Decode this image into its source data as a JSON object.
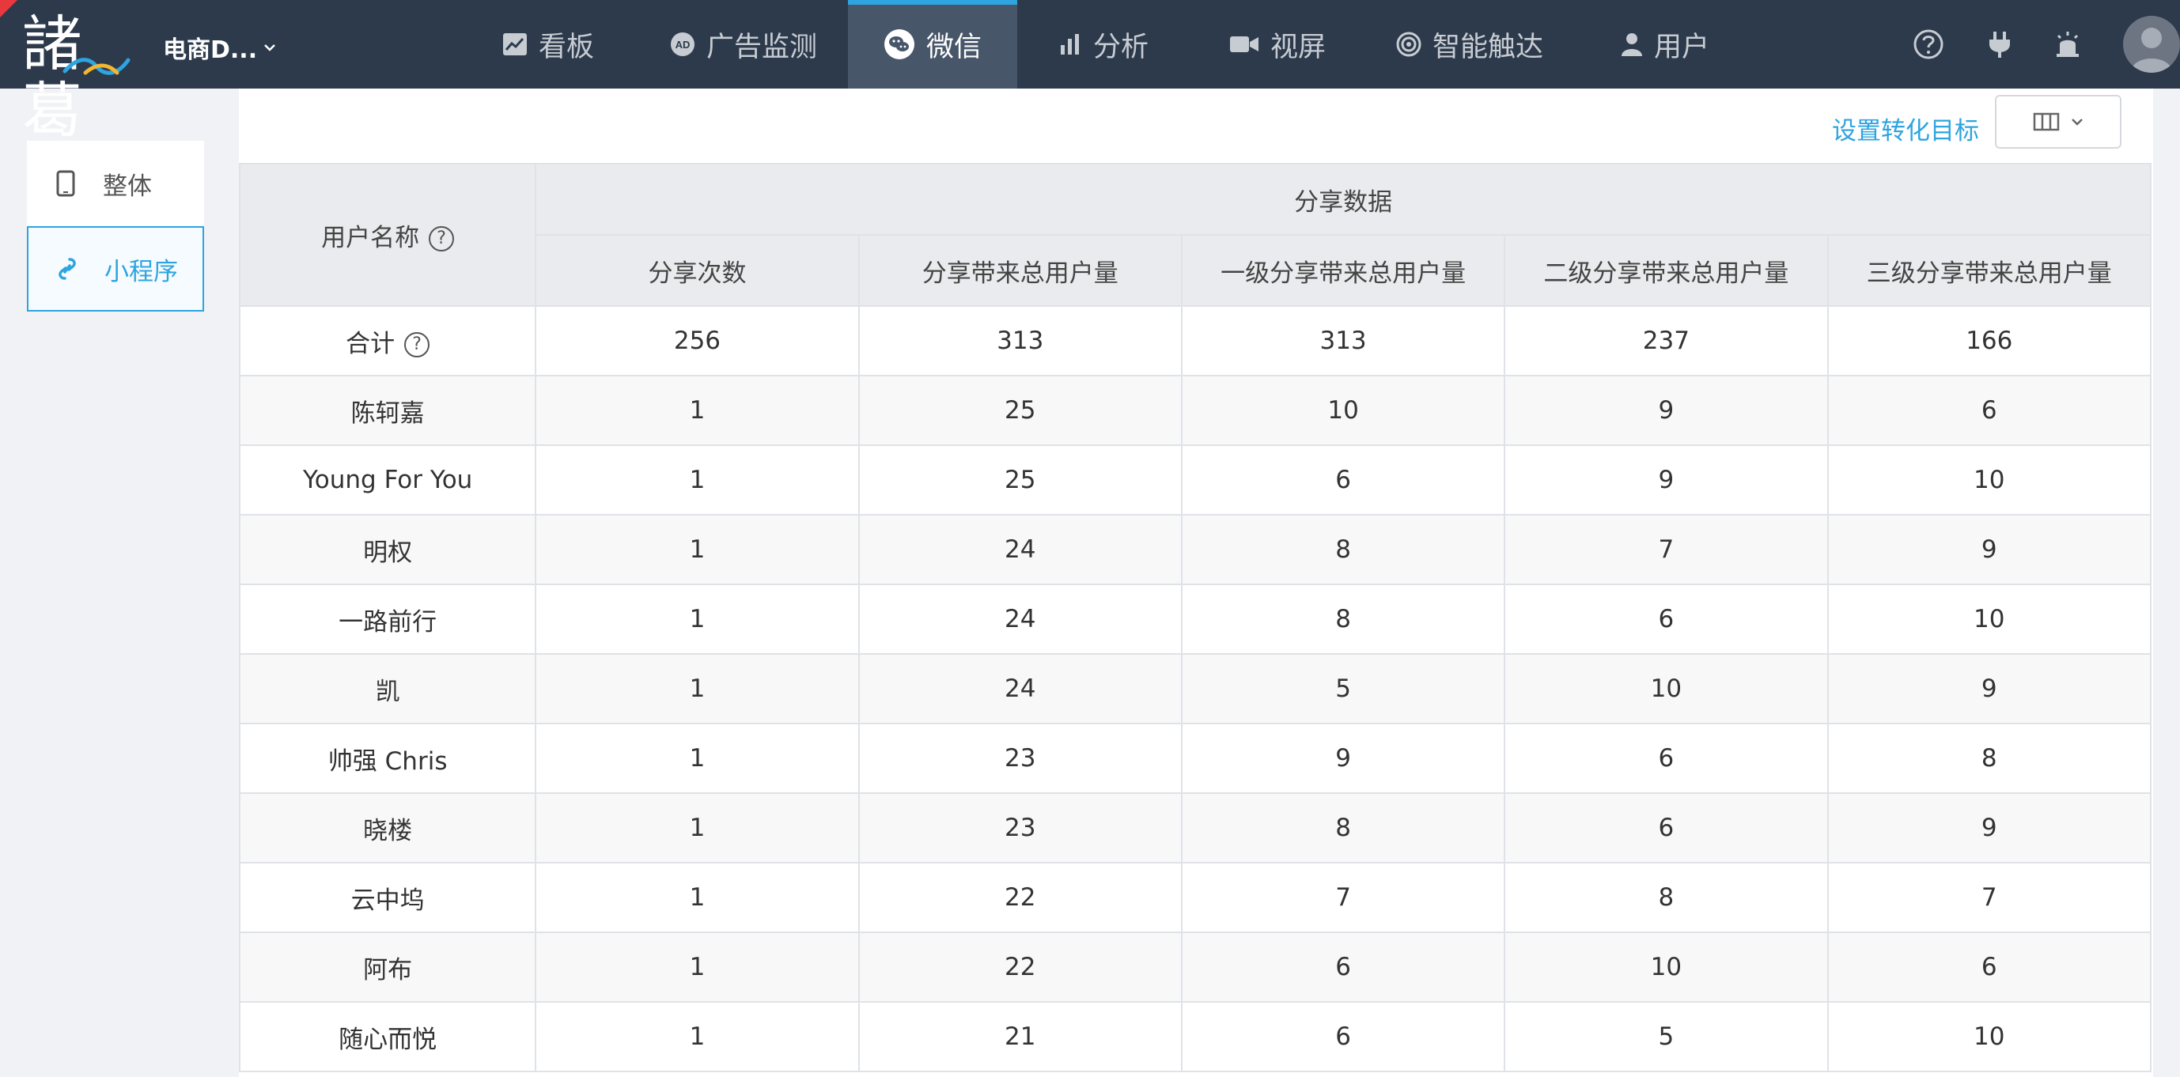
{
  "app": {
    "logo_text": "諸葛",
    "project_name": "电商D...",
    "accent_color": "#2ea4e0",
    "topbar_color": "#2d3a4b"
  },
  "nav": {
    "items": [
      {
        "label": "看板",
        "icon": "chart-icon"
      },
      {
        "label": "广告监测",
        "icon": "ad-icon"
      },
      {
        "label": "微信",
        "icon": "wechat-icon",
        "active": true
      },
      {
        "label": "分析",
        "icon": "bar-chart-icon"
      },
      {
        "label": "视屏",
        "icon": "video-camera-icon"
      },
      {
        "label": "智能触达",
        "icon": "target-icon"
      },
      {
        "label": "用户",
        "icon": "user-icon"
      }
    ],
    "right_icons": [
      "help-icon",
      "plug-icon",
      "alarm-icon",
      "avatar"
    ]
  },
  "sidebar": {
    "items": [
      {
        "label": "整体",
        "icon": "phone-icon"
      },
      {
        "label": "小程序",
        "icon": "link-icon",
        "active": true
      }
    ]
  },
  "toolbar": {
    "set_goal_label": "设置转化目标",
    "column_button_icon": "columns-icon"
  },
  "table": {
    "user_header": "用户名称",
    "group_header": "分享数据",
    "columns": [
      "分享次数",
      "分享带来总用户量",
      "一级分享带来总用户量",
      "二级分享带来总用户量",
      "三级分享带来总用户量"
    ],
    "total_label": "合计",
    "total": [
      "256",
      "313",
      "313",
      "237",
      "166"
    ],
    "rows": [
      {
        "name": "陈轲嘉",
        "values": [
          "1",
          "25",
          "10",
          "9",
          "6"
        ]
      },
      {
        "name": "Young For You",
        "values": [
          "1",
          "25",
          "6",
          "9",
          "10"
        ]
      },
      {
        "name": "明权",
        "values": [
          "1",
          "24",
          "8",
          "7",
          "9"
        ]
      },
      {
        "name": "一路前行",
        "values": [
          "1",
          "24",
          "8",
          "6",
          "10"
        ]
      },
      {
        "name": "凯",
        "values": [
          "1",
          "24",
          "5",
          "10",
          "9"
        ]
      },
      {
        "name": "帅强 Chris",
        "values": [
          "1",
          "23",
          "9",
          "6",
          "8"
        ]
      },
      {
        "name": "晓楼",
        "values": [
          "1",
          "23",
          "8",
          "6",
          "9"
        ]
      },
      {
        "name": "云中坞",
        "values": [
          "1",
          "22",
          "7",
          "8",
          "7"
        ]
      },
      {
        "name": "阿布",
        "values": [
          "1",
          "22",
          "6",
          "10",
          "6"
        ]
      },
      {
        "name": "随心而悦",
        "values": [
          "1",
          "21",
          "6",
          "5",
          "10"
        ]
      }
    ]
  }
}
